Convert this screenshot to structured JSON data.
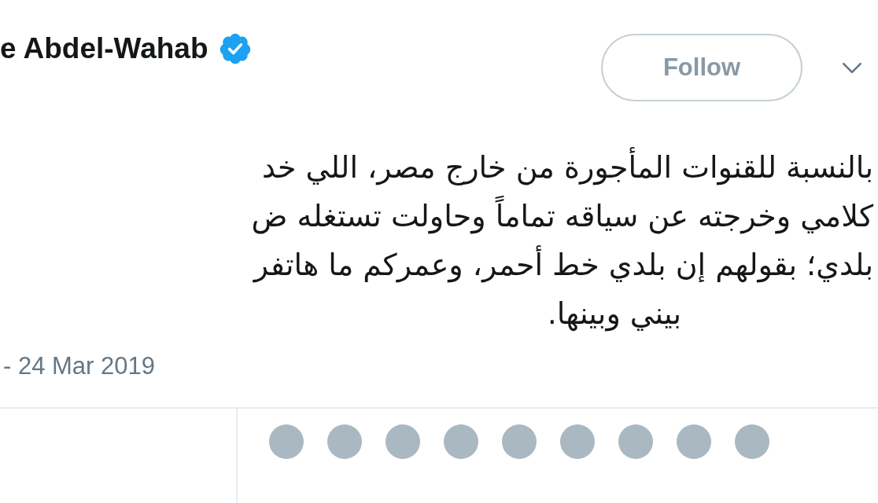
{
  "author": {
    "name": "e Abdel-Wahab",
    "verified": true
  },
  "follow_button": {
    "label": "Follow"
  },
  "tweet": {
    "lines": [
      "بالنسبة للقنوات المأجورة من خارج مصر، اللي خد",
      "كلامي وخرجته عن سياقه تماماً وحاولت تستغله ض",
      "بلدي؛ بقولهم إن بلدي خط أحمر، وعمركم ما هاتفر"
    ],
    "closing_line": "بيني وبينها."
  },
  "timestamp": "- 24 Mar 2019"
}
